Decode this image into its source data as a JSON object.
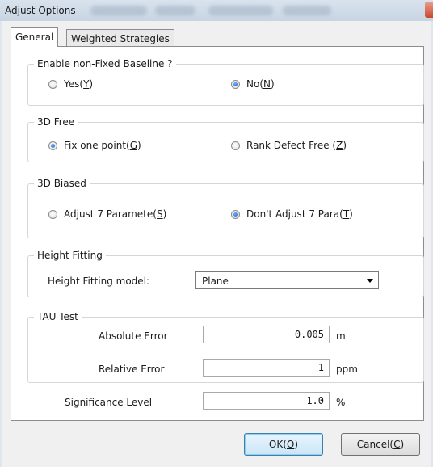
{
  "window": {
    "title": "Adjust Options"
  },
  "tabs": [
    {
      "label": "General",
      "active": true
    },
    {
      "label": "Weighted Strategies",
      "active": false
    }
  ],
  "baseline": {
    "title": "Enable non-Fixed Baseline ?",
    "yes_label": "Yes(",
    "yes_key": "Y",
    "yes_close": ")",
    "no_label": "No(",
    "no_key": "N",
    "no_close": ")",
    "selected": "No"
  },
  "free3d": {
    "title": "3D Free",
    "fix_label": "Fix one point(",
    "fix_key": "G",
    "fix_close": ")",
    "rank_label": "Rank Defect Free (",
    "rank_key": "Z",
    "rank_close": ")",
    "selected": "Fix one point"
  },
  "biased3d": {
    "title": "3D Biased",
    "adjust_label": "Adjust 7 Paramete(",
    "adjust_key": "S",
    "adjust_close": ")",
    "dont_label": "Don't Adjust 7 Para(",
    "dont_key": "T",
    "dont_close": ")",
    "selected": "Don't Adjust 7 Para"
  },
  "height": {
    "title": "Height Fitting",
    "model_label": "Height Fitting model:",
    "model_value": "Plane"
  },
  "tau": {
    "title": "TAU Test",
    "abs_label": "Absolute Error",
    "abs_value": "0.005",
    "abs_unit": "m",
    "rel_label": "Relative Error",
    "rel_value": "1",
    "rel_unit": "ppm"
  },
  "significance": {
    "label": "Significance Level",
    "value": "1.0",
    "unit": "%"
  },
  "buttons": {
    "ok_label": "OK(",
    "ok_key": "O",
    "ok_close": ")",
    "cancel_label": "Cancel(",
    "cancel_key": "C",
    "cancel_close": ")"
  },
  "colors": {
    "accent": "#1c5fbf",
    "default_button": "#3c7fb1"
  }
}
